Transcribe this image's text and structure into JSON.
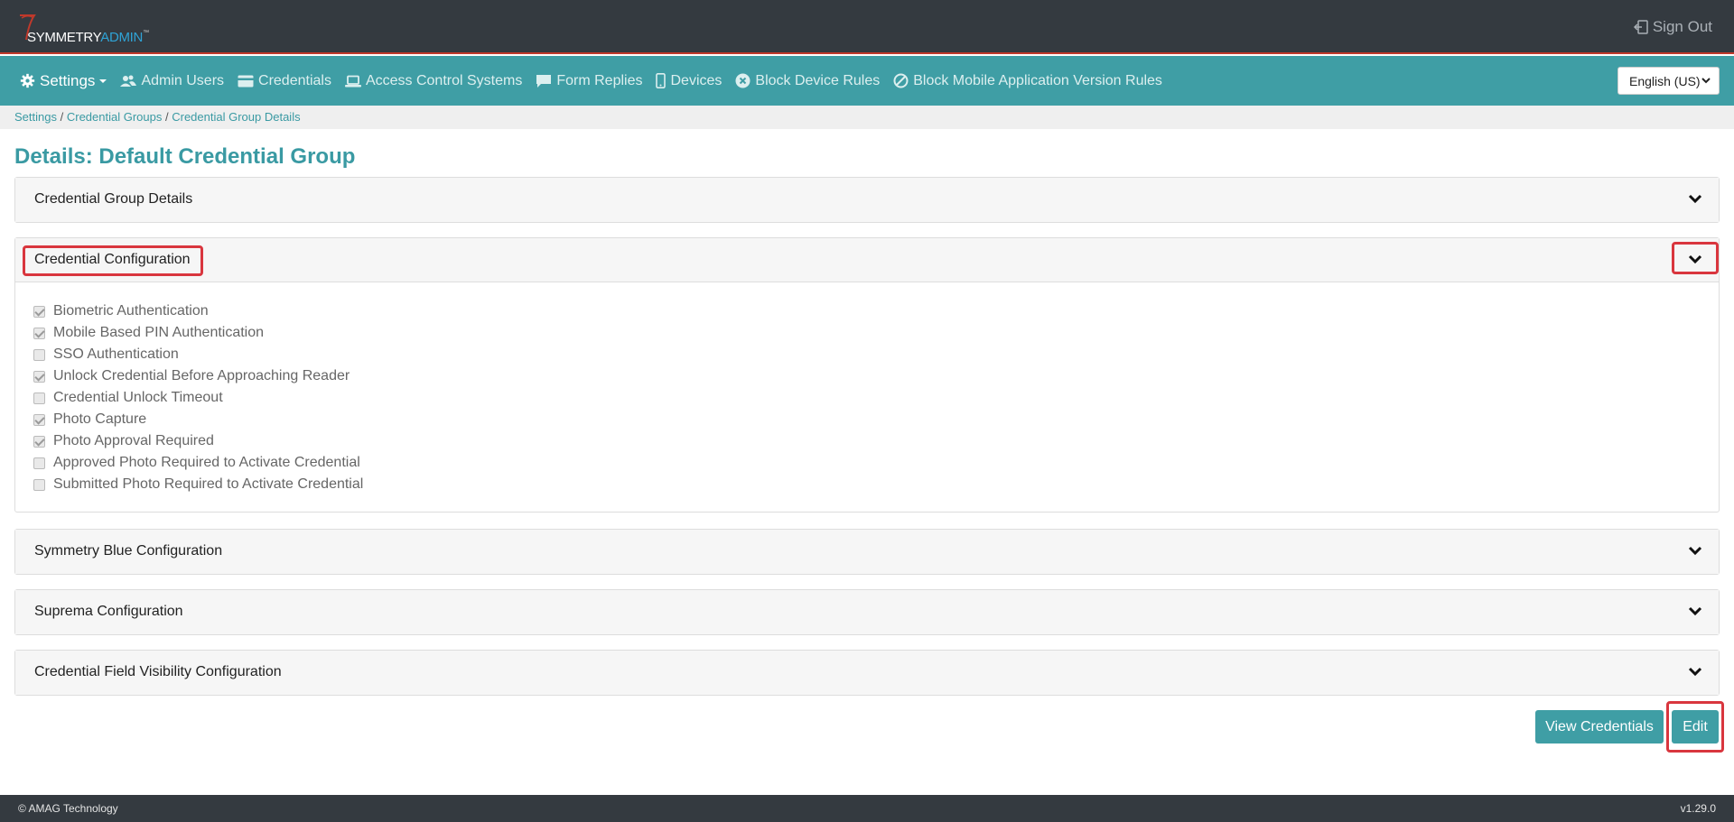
{
  "header": {
    "logo_text_main": "SYMMETRY",
    "logo_text_accent": "ADMIN",
    "logo_tm": "™",
    "sign_out_label": "Sign Out"
  },
  "nav": {
    "items": [
      {
        "label": "Settings",
        "icon": "gear-icon"
      },
      {
        "label": "Admin Users",
        "icon": "users-icon"
      },
      {
        "label": "Credentials",
        "icon": "credit-card-icon"
      },
      {
        "label": "Access Control Systems",
        "icon": "laptop-icon"
      },
      {
        "label": "Form Replies",
        "icon": "comment-icon"
      },
      {
        "label": "Devices",
        "icon": "mobile-icon"
      },
      {
        "label": "Block Device Rules",
        "icon": "times-circle-icon"
      },
      {
        "label": "Block Mobile Application Version Rules",
        "icon": "ban-icon"
      }
    ],
    "language": "English (US)"
  },
  "breadcrumbs": {
    "items": [
      "Settings",
      "Credential Groups",
      "Credential Group Details"
    ],
    "separator": "/"
  },
  "page": {
    "title": "Details: Default Credential Group"
  },
  "panels": [
    {
      "title": "Credential Group Details"
    },
    {
      "title": "Credential Configuration"
    },
    {
      "title": "Symmetry Blue Configuration"
    },
    {
      "title": "Suprema Configuration"
    },
    {
      "title": "Credential Field Visibility Configuration"
    }
  ],
  "credential_config_options": [
    {
      "label": "Biometric Authentication",
      "checked": true
    },
    {
      "label": "Mobile Based PIN Authentication",
      "checked": true
    },
    {
      "label": "SSO Authentication",
      "checked": false
    },
    {
      "label": "Unlock Credential Before Approaching Reader",
      "checked": true
    },
    {
      "label": "Credential Unlock Timeout",
      "checked": false
    },
    {
      "label": "Photo Capture",
      "checked": true
    },
    {
      "label": "Photo Approval Required",
      "checked": true
    },
    {
      "label": "Approved Photo Required to Activate Credential",
      "checked": false
    },
    {
      "label": "Submitted Photo Required to Activate Credential",
      "checked": false
    }
  ],
  "actions": {
    "view_credentials_label": "View Credentials",
    "edit_label": "Edit"
  },
  "footer": {
    "copyright": "© AMAG Technology",
    "version": "v1.29.0"
  },
  "colors": {
    "accent": "#3f9ea5",
    "header_bg": "#343a40",
    "highlight": "#d9363e"
  }
}
